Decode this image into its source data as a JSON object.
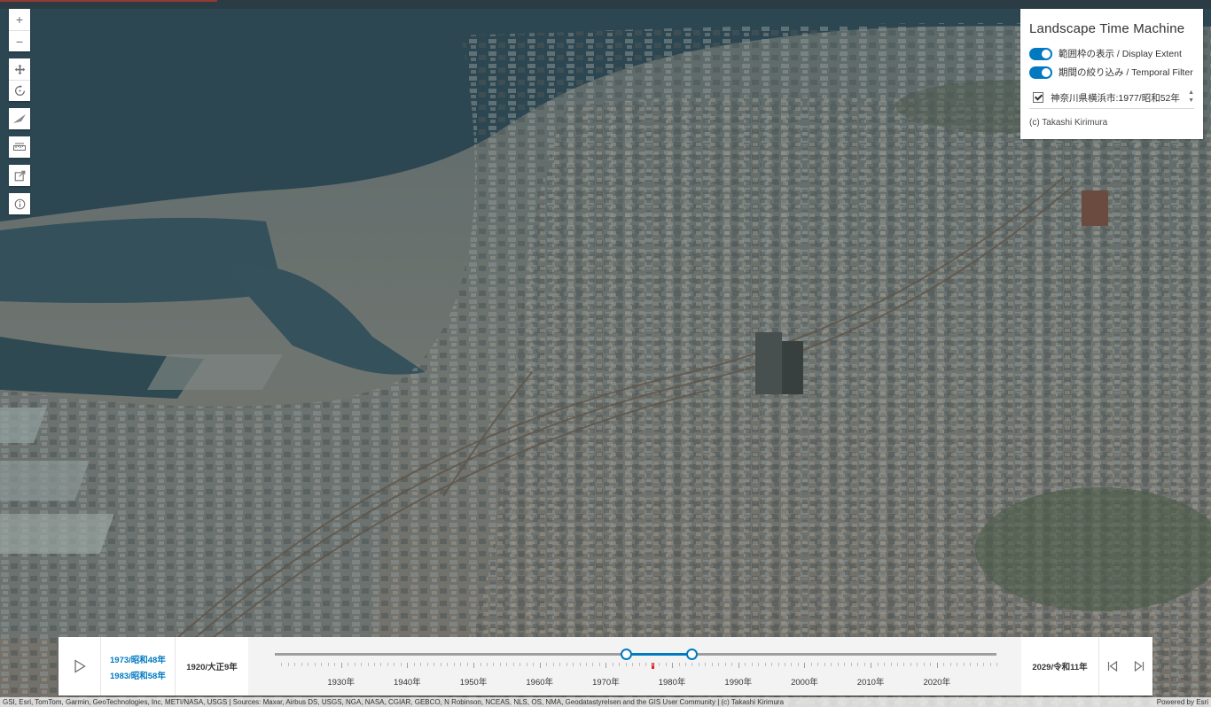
{
  "toolbar": {
    "zoom_in": "+",
    "zoom_out": "−",
    "tools": [
      "pan-icon",
      "rotate-icon",
      "compass-icon",
      "measure-icon",
      "share-icon",
      "info-icon"
    ]
  },
  "panel": {
    "title": "Landscape Time Machine",
    "toggles": [
      {
        "label": "範囲枠の表示 / Display Extent",
        "on": true
      },
      {
        "label": "期間の絞り込み / Temporal Filter",
        "on": true
      }
    ],
    "layer": {
      "label": "神奈川県横浜市:1977/昭和52年",
      "checked": true
    },
    "credit": "(c) Takashi Kirimura"
  },
  "time_slider": {
    "play_icon": "play-icon",
    "range_start": "1973/昭和48年",
    "range_end": "1983/昭和58年",
    "min_label": "1920/大正9年",
    "max_label": "2029/令和11年",
    "min_year": 1920,
    "max_year": 2029,
    "selected_start_year": 1973,
    "selected_end_year": 1983,
    "marker_year": 1977,
    "tick_labels": [
      "1930年",
      "1940年",
      "1950年",
      "1960年",
      "1970年",
      "1980年",
      "1990年",
      "2000年",
      "2010年",
      "2020年"
    ],
    "prev_icon": "previous-icon",
    "next_icon": "next-icon"
  },
  "attribution": {
    "sources": "GSI, Esri, TomTom, Garmin, GeoTechnologies, Inc, METI/NASA, USGS | Sources: Maxar, Airbus DS, USGS, NGA, NASA, CGIAR, GEBCO, N Robinson, NCEAS, NLS, OS, NMA, Geodatastyrelsen and the GIS User Community | (c) Takashi Kirimura",
    "powered_by": "Powered by Esri"
  },
  "colors": {
    "accent": "#0079c1",
    "marker": "#e0201c"
  }
}
